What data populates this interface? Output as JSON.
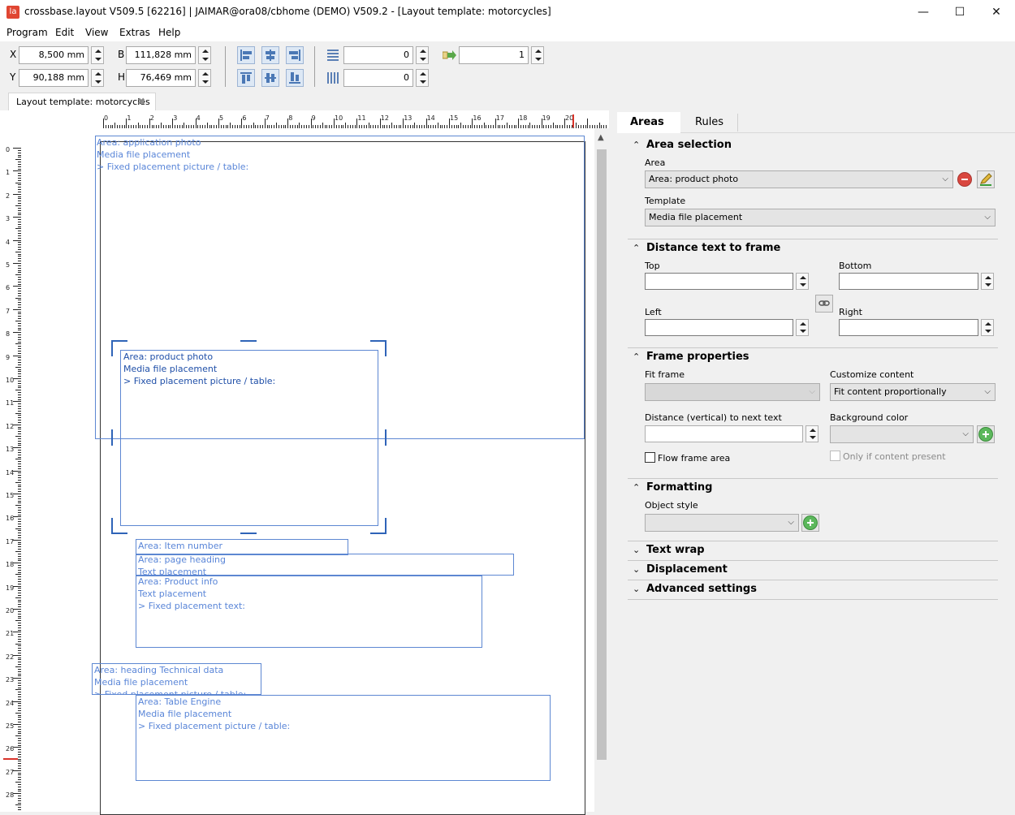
{
  "window": {
    "title": "crossbase.layout V509.5 [62216] | JAIMAR@ora08/cbhome (DEMO) V509.2   - [Layout template: motorcycles]",
    "app_icon_text": "la",
    "minimize": "—",
    "maximize": "☐",
    "close": "✕"
  },
  "menu": [
    "Program",
    "Edit",
    "View",
    "Extras",
    "Help"
  ],
  "toolbar": {
    "x_label": "X",
    "x_value": "8,500 mm",
    "y_label": "Y",
    "y_value": "90,188 mm",
    "b_label": "B",
    "b_value": "111,828 mm",
    "h_label": "H",
    "h_value": "76,469 mm",
    "rows_value": "0",
    "cols_value": "0",
    "page_value": "1"
  },
  "document_tab": {
    "label": "Layout template: motorcycles",
    "close": "✖"
  },
  "ruler": {
    "top_numbers": [
      "0",
      "1",
      "2",
      "3",
      "4",
      "5",
      "6",
      "7",
      "8",
      "9",
      "10",
      "11",
      "12",
      "13",
      "14",
      "15",
      "16",
      "17",
      "18",
      "19",
      "20"
    ],
    "left_numbers": [
      "0",
      "1",
      "2",
      "3",
      "4",
      "5",
      "6",
      "7",
      "8",
      "9",
      "10",
      "11",
      "12",
      "13",
      "14",
      "15",
      "16",
      "17",
      "18",
      "19",
      "20",
      "21",
      "22",
      "23",
      "24",
      "25",
      "26",
      "27",
      "28"
    ]
  },
  "areas": {
    "application_photo": {
      "title": "Area: application photo",
      "type": "Media file placement",
      "detail": " > Fixed placement picture / table:"
    },
    "product_photo": {
      "title": "Area: product photo",
      "type": "Media file placement",
      "detail": " > Fixed placement picture / table:"
    },
    "item_number": {
      "title": "Area: Item number"
    },
    "page_heading": {
      "title": "Area: page heading",
      "type": "Text placement"
    },
    "product_info": {
      "title": "Area: Product info",
      "type": "Text placement",
      "detail": " > Fixed placement text:"
    },
    "heading_technical": {
      "title": "Area: heading Technical data",
      "type": "Media file placement",
      "detail": " > Fixed placement picture / table:"
    },
    "table_engine": {
      "title": "Area: Table Engine",
      "type": "Media file placement",
      "detail": " > Fixed placement picture / table:"
    }
  },
  "panel": {
    "tabs": {
      "areas": "Areas",
      "rules": "Rules"
    },
    "area_selection": {
      "title": "Area selection",
      "area_label": "Area",
      "area_value": "Area: product photo",
      "template_label": "Template",
      "template_value": "Media file placement"
    },
    "distance": {
      "title": "Distance text to frame",
      "top": "Top",
      "bottom": "Bottom",
      "left": "Left",
      "right": "Right"
    },
    "frame": {
      "title": "Frame properties",
      "fit_frame": "Fit frame",
      "customize_content": "Customize content",
      "customize_value": "Fit content proportionally",
      "distance_vertical": "Distance (vertical) to next text",
      "background_color": "Background color",
      "flow_frame": "Flow frame area",
      "only_if_content": "Only if content present"
    },
    "formatting": {
      "title": "Formatting",
      "object_style": "Object style"
    },
    "text_wrap": "Text wrap",
    "displacement": "Displacement",
    "advanced": "Advanced settings"
  },
  "colors": {
    "area_line": "#5d87d2",
    "selection_bracket": "#2f64b8",
    "accent_red": "#e04632"
  }
}
